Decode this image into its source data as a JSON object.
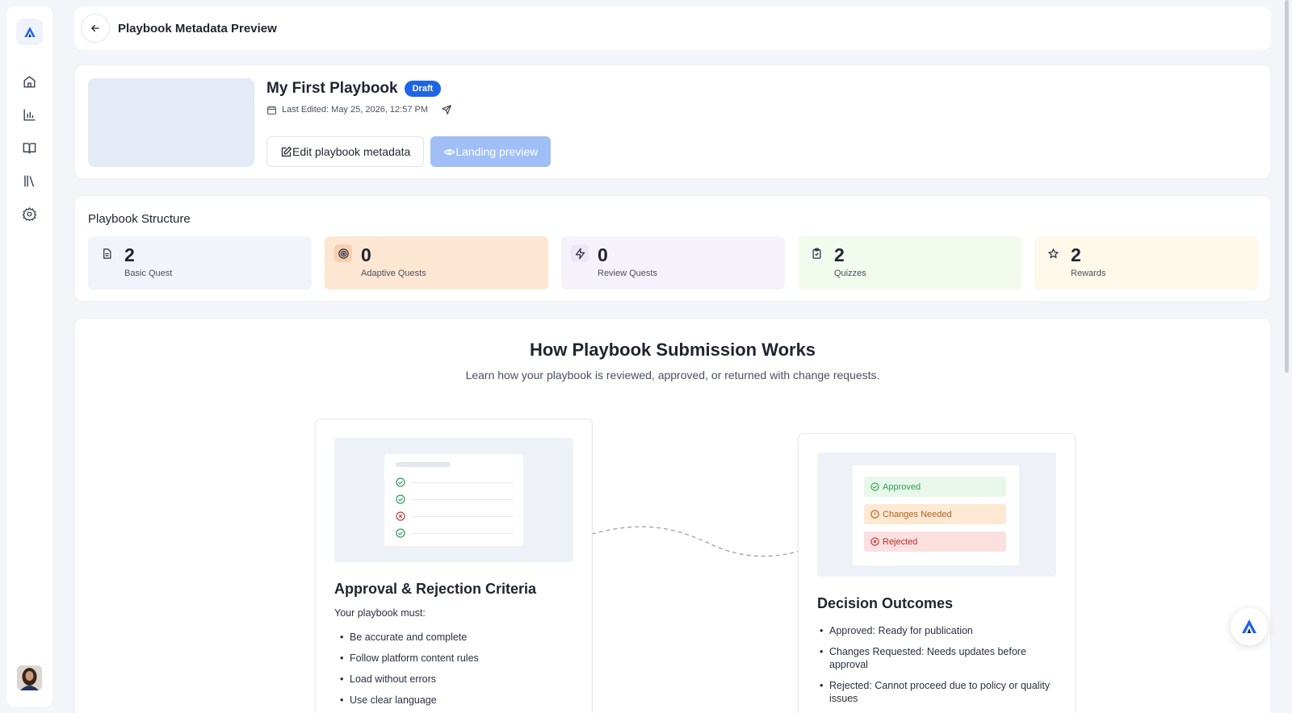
{
  "header": {
    "title": "Playbook Metadata Preview"
  },
  "sidebar": {
    "items": [
      {
        "name": "home-icon"
      },
      {
        "name": "chart-icon"
      },
      {
        "name": "book-icon"
      },
      {
        "name": "library-icon"
      },
      {
        "name": "gear-icon"
      }
    ]
  },
  "playbook": {
    "title": "My First Playbook",
    "status": "Draft",
    "last_edited": "Last Edited: May 25, 2026, 12:57 PM",
    "edit_button": "Edit playbook metadata",
    "preview_button": "Landing preview"
  },
  "structure": {
    "title": "Playbook Structure",
    "stats": [
      {
        "value": "2",
        "label": "Basic Quest",
        "bg": "#f1f4fa",
        "icon_bg": "transparent"
      },
      {
        "value": "0",
        "label": "Adaptive Quests",
        "bg": "#fde6d2",
        "icon_bg": "#f7cfae"
      },
      {
        "value": "0",
        "label": "Review Quests",
        "bg": "#f5f2fb",
        "icon_bg": "#ede6f8"
      },
      {
        "value": "2",
        "label": "Quizzes",
        "bg": "#f2fbee",
        "icon_bg": "transparent"
      },
      {
        "value": "2",
        "label": "Rewards",
        "bg": "#fef8e9",
        "icon_bg": "transparent"
      }
    ]
  },
  "how": {
    "title": "How Playbook Submission Works",
    "subtitle": "Learn how your playbook is reviewed, approved, or returned with change requests.",
    "criteria": {
      "title": "Approval & Rejection Criteria",
      "intro": "Your playbook must:",
      "items": [
        "Be accurate and complete",
        "Follow platform content rules",
        "Load without errors",
        "Use clear language"
      ]
    },
    "outcomes": {
      "title": "Decision Outcomes",
      "pills": [
        "Approved",
        "Changes Needed",
        "Rejected"
      ],
      "items": [
        "Approved: Ready for publication",
        "Changes Requested: Needs updates before approval",
        "Rejected: Cannot proceed due to policy or quality issues"
      ]
    }
  },
  "colors": {
    "accent": "#1f64e6",
    "accent_light": "#9fbff6",
    "success": "#2f9e57",
    "warning": "#c8742a",
    "danger": "#c93a3a"
  }
}
